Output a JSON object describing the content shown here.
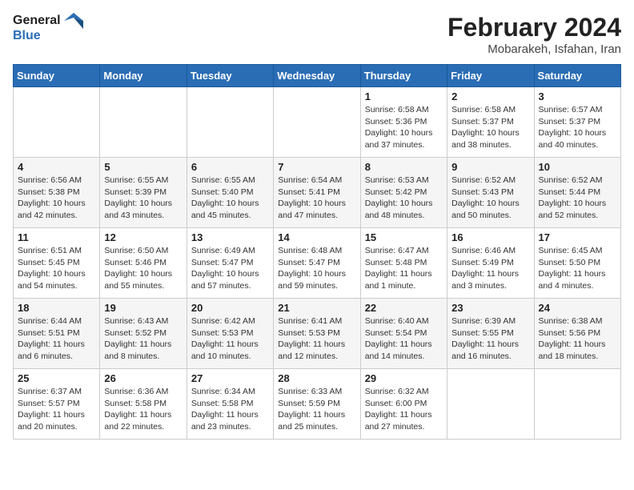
{
  "header": {
    "logo_line1": "General",
    "logo_line2": "Blue",
    "month": "February 2024",
    "location": "Mobarakeh, Isfahan, Iran"
  },
  "days_of_week": [
    "Sunday",
    "Monday",
    "Tuesday",
    "Wednesday",
    "Thursday",
    "Friday",
    "Saturday"
  ],
  "weeks": [
    [
      {
        "day": "",
        "info": ""
      },
      {
        "day": "",
        "info": ""
      },
      {
        "day": "",
        "info": ""
      },
      {
        "day": "",
        "info": ""
      },
      {
        "day": "1",
        "info": "Sunrise: 6:58 AM\nSunset: 5:36 PM\nDaylight: 10 hours and 37 minutes."
      },
      {
        "day": "2",
        "info": "Sunrise: 6:58 AM\nSunset: 5:37 PM\nDaylight: 10 hours and 38 minutes."
      },
      {
        "day": "3",
        "info": "Sunrise: 6:57 AM\nSunset: 5:37 PM\nDaylight: 10 hours and 40 minutes."
      }
    ],
    [
      {
        "day": "4",
        "info": "Sunrise: 6:56 AM\nSunset: 5:38 PM\nDaylight: 10 hours and 42 minutes."
      },
      {
        "day": "5",
        "info": "Sunrise: 6:55 AM\nSunset: 5:39 PM\nDaylight: 10 hours and 43 minutes."
      },
      {
        "day": "6",
        "info": "Sunrise: 6:55 AM\nSunset: 5:40 PM\nDaylight: 10 hours and 45 minutes."
      },
      {
        "day": "7",
        "info": "Sunrise: 6:54 AM\nSunset: 5:41 PM\nDaylight: 10 hours and 47 minutes."
      },
      {
        "day": "8",
        "info": "Sunrise: 6:53 AM\nSunset: 5:42 PM\nDaylight: 10 hours and 48 minutes."
      },
      {
        "day": "9",
        "info": "Sunrise: 6:52 AM\nSunset: 5:43 PM\nDaylight: 10 hours and 50 minutes."
      },
      {
        "day": "10",
        "info": "Sunrise: 6:52 AM\nSunset: 5:44 PM\nDaylight: 10 hours and 52 minutes."
      }
    ],
    [
      {
        "day": "11",
        "info": "Sunrise: 6:51 AM\nSunset: 5:45 PM\nDaylight: 10 hours and 54 minutes."
      },
      {
        "day": "12",
        "info": "Sunrise: 6:50 AM\nSunset: 5:46 PM\nDaylight: 10 hours and 55 minutes."
      },
      {
        "day": "13",
        "info": "Sunrise: 6:49 AM\nSunset: 5:47 PM\nDaylight: 10 hours and 57 minutes."
      },
      {
        "day": "14",
        "info": "Sunrise: 6:48 AM\nSunset: 5:47 PM\nDaylight: 10 hours and 59 minutes."
      },
      {
        "day": "15",
        "info": "Sunrise: 6:47 AM\nSunset: 5:48 PM\nDaylight: 11 hours and 1 minute."
      },
      {
        "day": "16",
        "info": "Sunrise: 6:46 AM\nSunset: 5:49 PM\nDaylight: 11 hours and 3 minutes."
      },
      {
        "day": "17",
        "info": "Sunrise: 6:45 AM\nSunset: 5:50 PM\nDaylight: 11 hours and 4 minutes."
      }
    ],
    [
      {
        "day": "18",
        "info": "Sunrise: 6:44 AM\nSunset: 5:51 PM\nDaylight: 11 hours and 6 minutes."
      },
      {
        "day": "19",
        "info": "Sunrise: 6:43 AM\nSunset: 5:52 PM\nDaylight: 11 hours and 8 minutes."
      },
      {
        "day": "20",
        "info": "Sunrise: 6:42 AM\nSunset: 5:53 PM\nDaylight: 11 hours and 10 minutes."
      },
      {
        "day": "21",
        "info": "Sunrise: 6:41 AM\nSunset: 5:53 PM\nDaylight: 11 hours and 12 minutes."
      },
      {
        "day": "22",
        "info": "Sunrise: 6:40 AM\nSunset: 5:54 PM\nDaylight: 11 hours and 14 minutes."
      },
      {
        "day": "23",
        "info": "Sunrise: 6:39 AM\nSunset: 5:55 PM\nDaylight: 11 hours and 16 minutes."
      },
      {
        "day": "24",
        "info": "Sunrise: 6:38 AM\nSunset: 5:56 PM\nDaylight: 11 hours and 18 minutes."
      }
    ],
    [
      {
        "day": "25",
        "info": "Sunrise: 6:37 AM\nSunset: 5:57 PM\nDaylight: 11 hours and 20 minutes."
      },
      {
        "day": "26",
        "info": "Sunrise: 6:36 AM\nSunset: 5:58 PM\nDaylight: 11 hours and 22 minutes."
      },
      {
        "day": "27",
        "info": "Sunrise: 6:34 AM\nSunset: 5:58 PM\nDaylight: 11 hours and 23 minutes."
      },
      {
        "day": "28",
        "info": "Sunrise: 6:33 AM\nSunset: 5:59 PM\nDaylight: 11 hours and 25 minutes."
      },
      {
        "day": "29",
        "info": "Sunrise: 6:32 AM\nSunset: 6:00 PM\nDaylight: 11 hours and 27 minutes."
      },
      {
        "day": "",
        "info": ""
      },
      {
        "day": "",
        "info": ""
      }
    ]
  ]
}
